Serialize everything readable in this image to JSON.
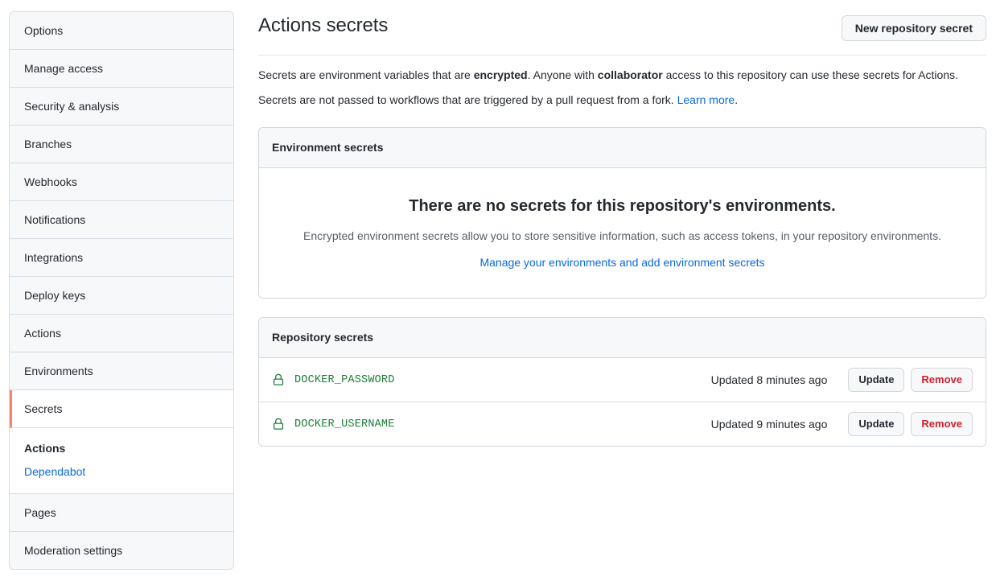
{
  "sidebar": {
    "items": [
      {
        "label": "Options",
        "selected": false
      },
      {
        "label": "Manage access",
        "selected": false
      },
      {
        "label": "Security & analysis",
        "selected": false
      },
      {
        "label": "Branches",
        "selected": false
      },
      {
        "label": "Webhooks",
        "selected": false
      },
      {
        "label": "Notifications",
        "selected": false
      },
      {
        "label": "Integrations",
        "selected": false
      },
      {
        "label": "Deploy keys",
        "selected": false
      },
      {
        "label": "Actions",
        "selected": false
      },
      {
        "label": "Environments",
        "selected": false
      },
      {
        "label": "Secrets",
        "selected": true
      }
    ],
    "subsection": {
      "current": "Actions",
      "link": "Dependabot"
    },
    "items_after": [
      {
        "label": "Pages",
        "selected": false
      },
      {
        "label": "Moderation settings",
        "selected": false
      }
    ],
    "selected_accent_color": "#f9826c"
  },
  "header": {
    "title": "Actions secrets",
    "new_secret_button": "New repository secret"
  },
  "description": {
    "line1_part1": "Secrets are environment variables that are ",
    "line1_bold1": "encrypted",
    "line1_part2": ". Anyone with ",
    "line1_bold2": "collaborator",
    "line1_part3": " access to this repository can use these secrets for Actions.",
    "line2_part1": "Secrets are not passed to workflows that are triggered by a pull request from a fork. ",
    "line2_link": "Learn more",
    "line2_part2": "."
  },
  "environment_secrets": {
    "header": "Environment secrets",
    "blank_title": "There are no secrets for this repository's environments.",
    "blank_text": "Encrypted environment secrets allow you to store sensitive information, such as access tokens, in your repository environments.",
    "blank_link": "Manage your environments and add environment secrets"
  },
  "repository_secrets": {
    "header": "Repository secrets",
    "secret_name_color": "#1a7f37",
    "rows": [
      {
        "icon": "lock-icon",
        "name": "DOCKER_PASSWORD",
        "updated": "Updated 8 minutes ago",
        "update_label": "Update",
        "remove_label": "Remove"
      },
      {
        "icon": "lock-icon",
        "name": "DOCKER_USERNAME",
        "updated": "Updated 9 minutes ago",
        "update_label": "Update",
        "remove_label": "Remove"
      }
    ]
  }
}
